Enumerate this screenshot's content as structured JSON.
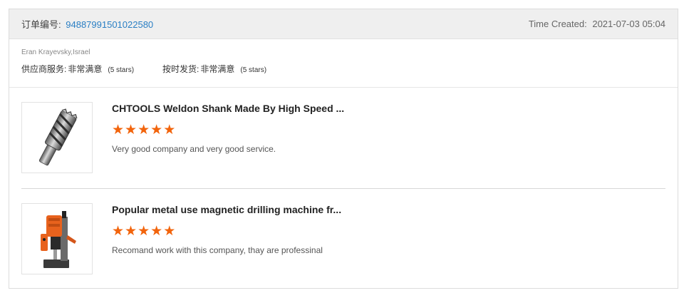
{
  "header": {
    "order_label": "订单编号:",
    "order_number": "94887991501022580",
    "time_label": "Time Created:",
    "time_value": "2021-07-03 05:04"
  },
  "buyer": {
    "name": "Eran Krayevsky,Israel",
    "ratings": [
      {
        "label": "供应商服务:",
        "value": "非常满意",
        "stars_text": "(5 stars)"
      },
      {
        "label": "按时发货:",
        "value": "非常满意",
        "stars_text": "(5 stars)"
      }
    ]
  },
  "items": [
    {
      "title": "CHTOOLS Weldon Shank Made By High Speed ...",
      "rating": 5,
      "review": "Very good company  and very good service.",
      "image_icon": "annular-cutter-icon"
    },
    {
      "title": "Popular metal use magnetic drilling machine fr...",
      "rating": 5,
      "review": "Recomand work with this company,  thay  are professinal",
      "image_icon": "magnetic-drill-icon"
    }
  ],
  "colors": {
    "star": "#f2640c",
    "link": "#2a7fc4"
  }
}
